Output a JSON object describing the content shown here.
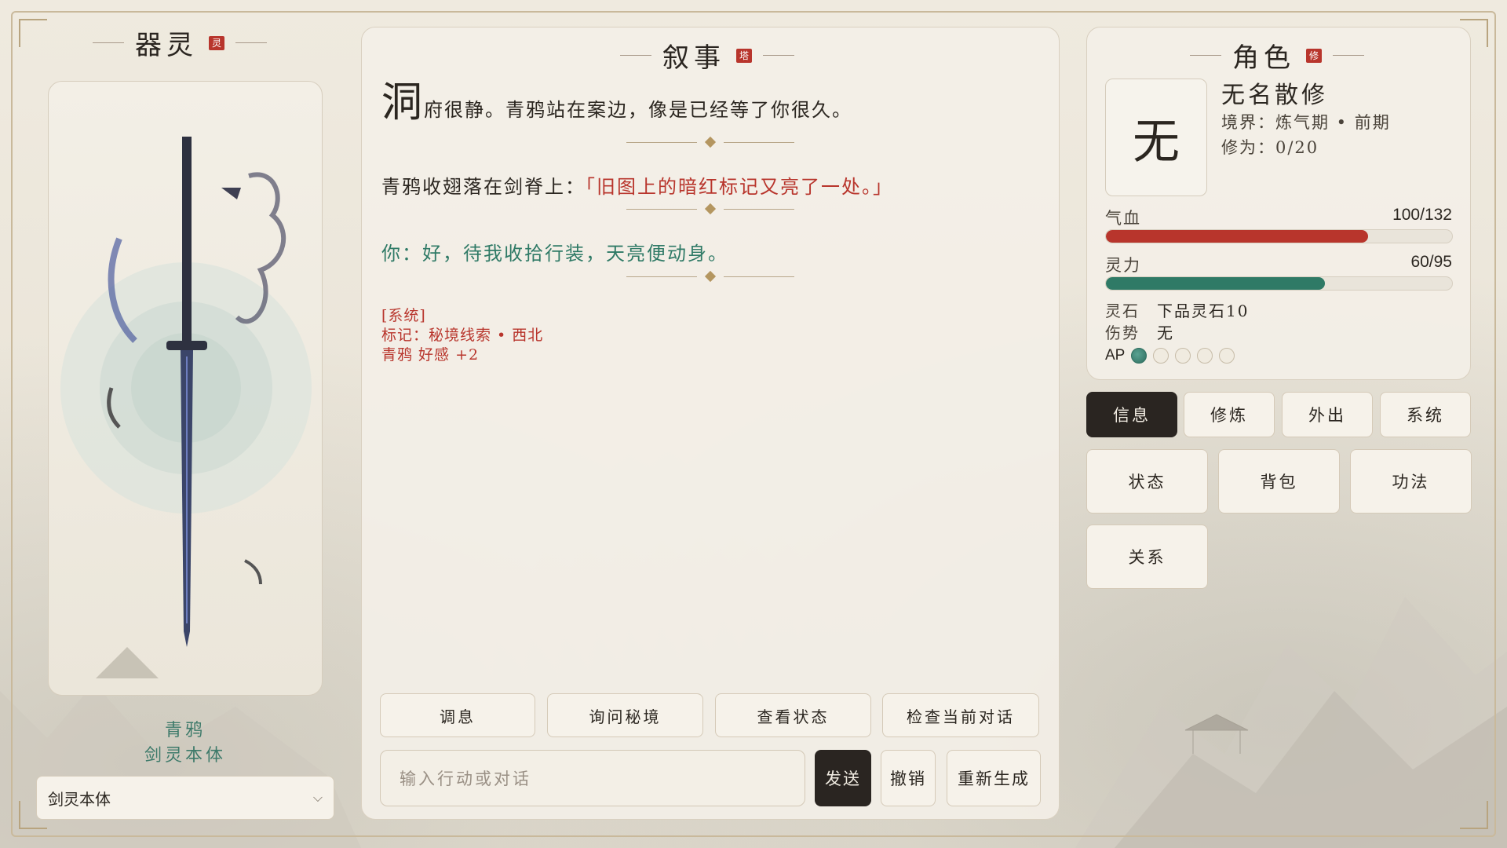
{
  "left_panel": {
    "title": "器灵",
    "seal": "灵",
    "spirit_name": "青鸦",
    "spirit_form": "剑灵本体",
    "form_select": {
      "value": "剑灵本体"
    }
  },
  "narrative": {
    "title": "叙事",
    "seal": "塔",
    "para1_initial": "洞",
    "para1_rest": "府很静。青鸦站在案边，像是已经等了你很久。",
    "para2_lead": "青鸦收翅落在剑脊上：",
    "para2_quote": "「旧图上的暗红标记又亮了一处。」",
    "para3": "你：好，待我收拾行装，天亮便动身。",
    "system_lines": [
      "[系统]",
      "标记：秘境线索 • 西北",
      "青鸦 好感 +2"
    ],
    "quick_actions": [
      "调息",
      "询问秘境",
      "查看状态",
      "检查当前对话"
    ],
    "input_placeholder": "输入行动或对话",
    "send_label": "发送",
    "undo_label": "撤销",
    "regen_label": "重新生成"
  },
  "character": {
    "title": "角色",
    "seal": "修",
    "avatar_char": "无",
    "name": "无名散修",
    "realm": "境界：炼气期 • 前期",
    "cultivation": "修为：0/20",
    "hp_label": "气血",
    "hp_value": "100/132",
    "hp_current": 100,
    "hp_max": 132,
    "mp_label": "灵力",
    "mp_value": "60/95",
    "mp_current": 60,
    "mp_max": 95,
    "stones_key": "灵石",
    "stones_val": "下品灵石10",
    "injury_key": "伤势",
    "injury_val": "无",
    "ap_label": "AP",
    "ap_filled": 1,
    "ap_total": 5,
    "colors": {
      "hp": "#b8352c",
      "mp": "#2f7a66"
    }
  },
  "tabs": [
    "信息",
    "修炼",
    "外出",
    "系统"
  ],
  "tiles": [
    "状态",
    "背包",
    "功法",
    "关系"
  ]
}
